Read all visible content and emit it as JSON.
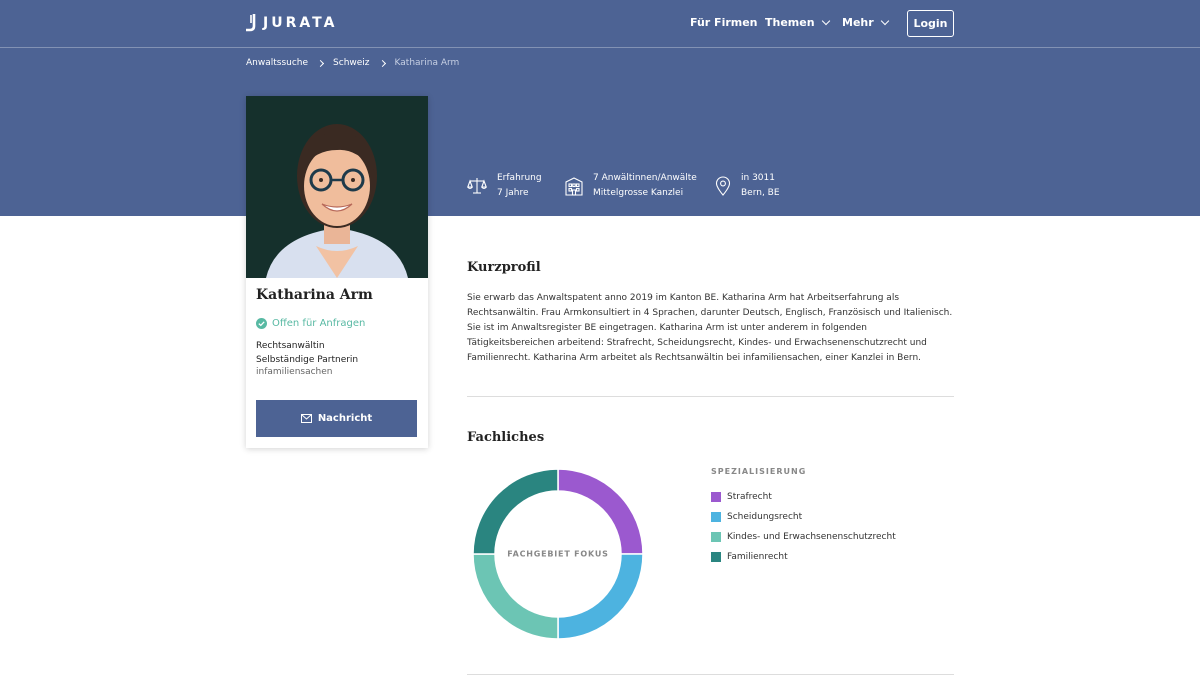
{
  "brand": {
    "name": "JURATA"
  },
  "nav": {
    "firms": "Für Firmen",
    "themes": "Themen",
    "more": "Mehr",
    "login": "Login"
  },
  "breadcrumb": [
    "Anwaltssuche",
    "Schweiz",
    "Katharina Arm"
  ],
  "stats": [
    {
      "icon": "scales-icon",
      "line1": "Erfahrung",
      "line2": "7 Jahre"
    },
    {
      "icon": "building-icon",
      "line1": "7 Anwältinnen/Anwälte",
      "line2": "Mittelgrosse Kanzlei"
    },
    {
      "icon": "location-pin-icon",
      "line1": "in 3011",
      "line2": "Bern, BE"
    }
  ],
  "card": {
    "name": "Katharina Arm",
    "status": "Offen für Anfragen",
    "role1": "Rechtsanwältin",
    "role2": "Selbständige Partnerin",
    "firm": "infamiliensachen",
    "message_button": "Nachricht"
  },
  "kurzprofil": {
    "title": "Kurzprofil",
    "text": "Sie erwarb das Anwaltspatent anno 2019 im Kanton BE. Katharina Arm hat Arbeitserfahrung als Rechtsanwältin. Frau Armkonsultiert in 4 Sprachen, darunter Deutsch, Englisch, Französisch und Italienisch. Sie ist im Anwaltsregister BE eingetragen. Katharina Arm ist unter anderem in folgenden Tätigkeitsbereichen arbeitend: Strafrecht, Scheidungsrecht, Kindes- und Erwachsenenschutzrecht und Familienrecht. Katharina Arm arbeitet als Rechtsanwältin bei infamiliensachen, einer Kanzlei in Bern."
  },
  "fachliches": {
    "title": "Fachliches",
    "donut_label": "FACHGEBIET FOKUS",
    "legend_title": "SPEZIALISIERUNG",
    "segments": [
      {
        "label": "Strafrecht",
        "value": 25,
        "color": "#9b59cf"
      },
      {
        "label": "Scheidungsrecht",
        "value": 25,
        "color": "#4db3e0"
      },
      {
        "label": "Kindes- und Erwachsenenschutzrecht",
        "value": 25,
        "color": "#6cc5b4"
      },
      {
        "label": "Familienrecht",
        "value": 25,
        "color": "#2a8580"
      }
    ]
  },
  "colors": {
    "hero": "#4d6394",
    "status": "#58b9a3"
  }
}
